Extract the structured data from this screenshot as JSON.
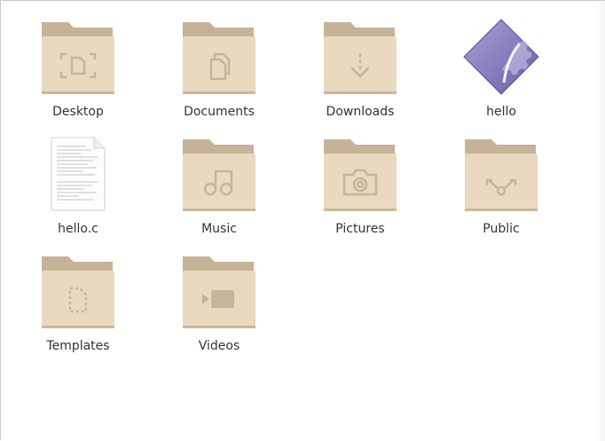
{
  "files": [
    {
      "label": "Desktop",
      "icon": "folder-desktop-icon"
    },
    {
      "label": "Documents",
      "icon": "folder-documents-icon"
    },
    {
      "label": "Downloads",
      "icon": "folder-download-icon"
    },
    {
      "label": "hello",
      "icon": "executable-icon"
    },
    {
      "label": "hello.c",
      "icon": "text-file-icon"
    },
    {
      "label": "Music",
      "icon": "folder-music-icon"
    },
    {
      "label": "Pictures",
      "icon": "folder-pictures-icon"
    },
    {
      "label": "Public",
      "icon": "folder-publicshare-icon"
    },
    {
      "label": "Templates",
      "icon": "folder-templates-icon"
    },
    {
      "label": "Videos",
      "icon": "folder-videos-icon"
    }
  ],
  "colors": {
    "folder_back": "#c6b396",
    "folder_front": "#e9d9bf",
    "folder_glyph": "#c8b496",
    "label_text": "#2e3436",
    "executable_purple": "#8b7fc0"
  }
}
